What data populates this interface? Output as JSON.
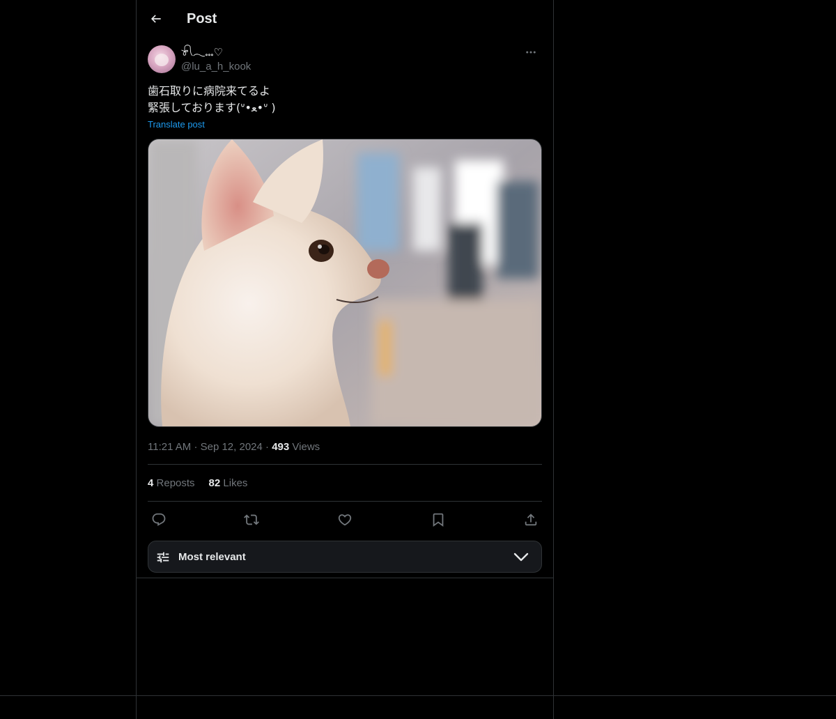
{
  "header": {
    "title": "Post",
    "back_icon": "arrow-left-icon"
  },
  "author": {
    "display_name": "𓍯𓂃𓏧♡",
    "handle": "@lu_a_h_kook",
    "avatar_icon": "avatar-image",
    "more_icon": "ellipsis-icon"
  },
  "post": {
    "text_line1": "歯石取りに病院来てるよ",
    "text_line2": "緊張しております(ᐡ•ﻌ•ᐡ )",
    "translate_label": "Translate post",
    "media_alt": "chihuahua-photo"
  },
  "meta": {
    "time": "11:21 AM",
    "separator1": "·",
    "date": "Sep 12, 2024",
    "separator2": "·",
    "views_count": "493",
    "views_label": "Views"
  },
  "stats": {
    "reposts_count": "4",
    "reposts_label": "Reposts",
    "likes_count": "82",
    "likes_label": "Likes"
  },
  "actions": {
    "reply_icon": "reply-icon",
    "repost_icon": "repost-icon",
    "like_icon": "heart-icon",
    "bookmark_icon": "bookmark-icon",
    "share_icon": "share-icon"
  },
  "sort": {
    "label": "Most relevant",
    "icon": "sliders-icon",
    "chevron": "chevron-down-icon"
  },
  "colors": {
    "background": "#000000",
    "text": "#e7e9ea",
    "secondary_text": "#71767b",
    "link": "#1d9bf0",
    "border": "#2f3336",
    "sort_bar_bg": "#16181c"
  }
}
